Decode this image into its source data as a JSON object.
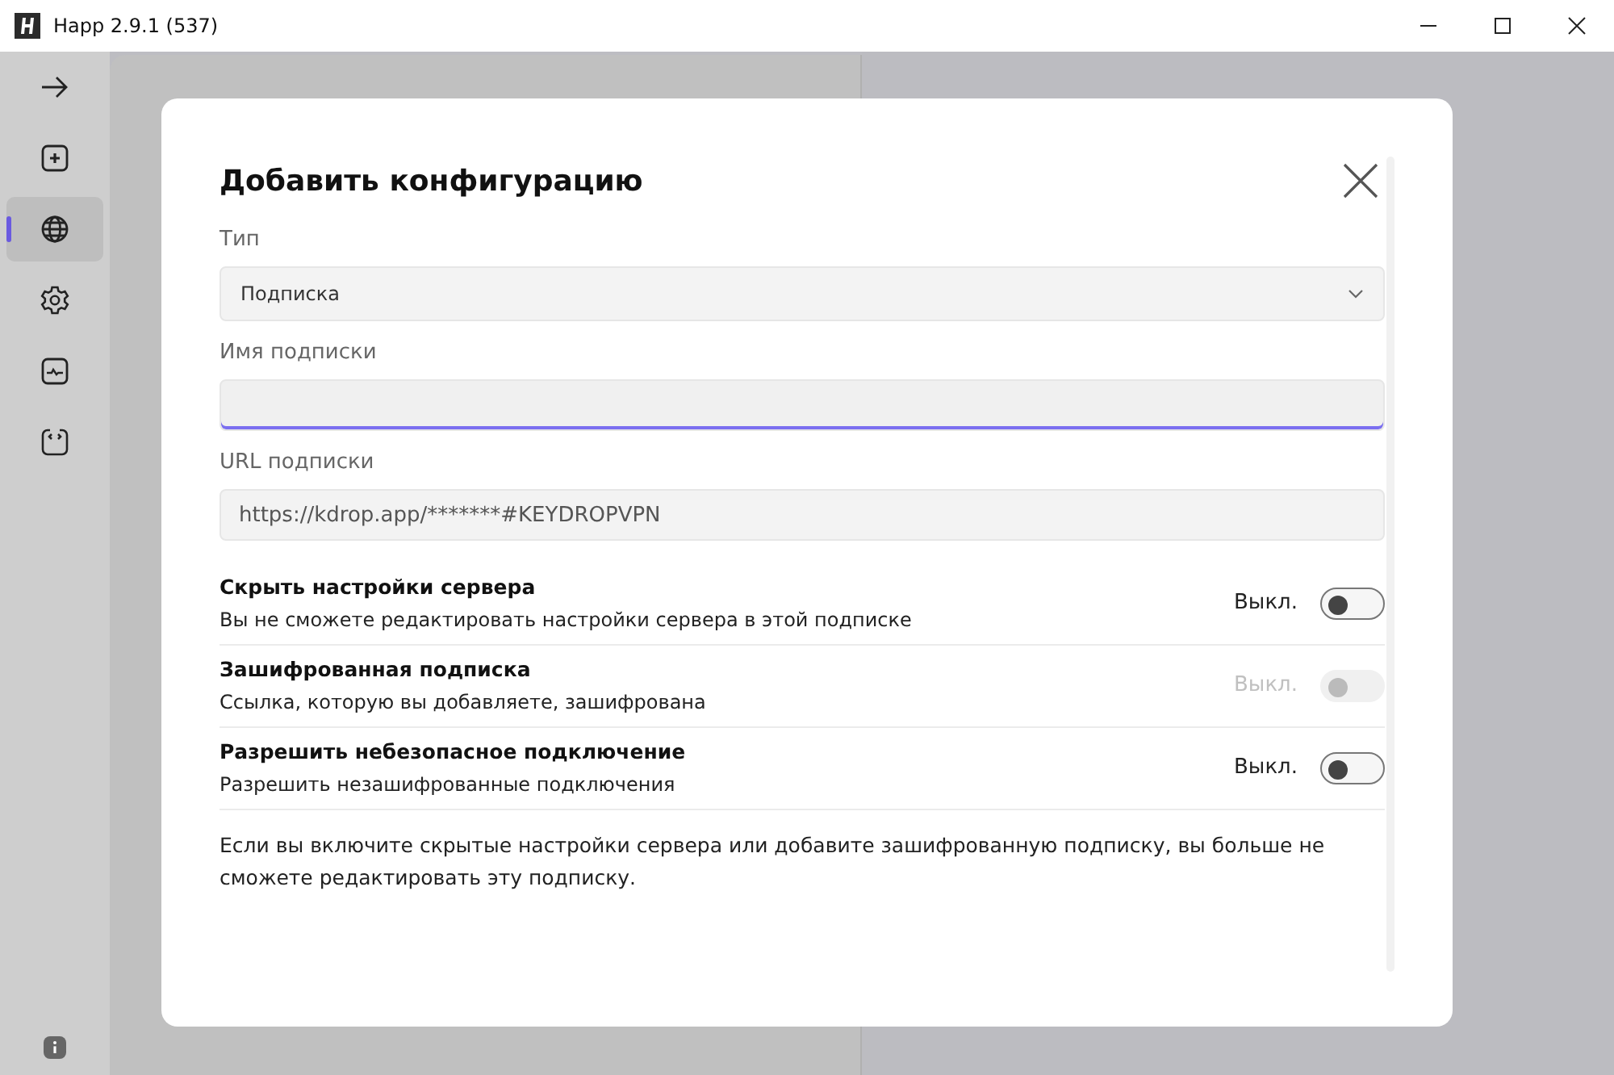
{
  "window": {
    "title": "Happ 2.9.1 (537)"
  },
  "sidebar": {
    "items": [
      {
        "kind": "arrow",
        "selected": false
      },
      {
        "kind": "add",
        "selected": false
      },
      {
        "kind": "globe",
        "selected": true
      },
      {
        "kind": "gear",
        "selected": false
      },
      {
        "kind": "monitor",
        "selected": false
      },
      {
        "kind": "code",
        "selected": false
      }
    ]
  },
  "dialog": {
    "title": "Добавить конфигурацию",
    "fields": [
      {
        "kind": "select",
        "label": "Тип",
        "value": "Подписка"
      },
      {
        "kind": "input",
        "label": "Имя подписки",
        "focused": true
      },
      {
        "kind": "input",
        "label": "URL подписки",
        "value": "https://kdrop.app/*******#KEYDROPVPN",
        "focused": false
      }
    ],
    "settings": [
      {
        "title": "Скрыть настройки сервера",
        "description": "Вы не сможете редактировать настройки сервера в этой подписке",
        "state": "Выкл.",
        "on": false,
        "disabled": false
      },
      {
        "title": "Зашифрованная подписка",
        "description": "Ссылка, которую вы добавляете, зашифрована",
        "state": "Выкл.",
        "on": false,
        "disabled": true
      },
      {
        "title": "Разрешить небезопасное подключение",
        "description": "Разрешить незашифрованные подключения",
        "state": "Выкл.",
        "on": false,
        "disabled": false
      }
    ],
    "note": "Если вы включите скрытые настройки сервера или добавите зашифрованную подписку, вы больше не сможете редактировать эту подписку."
  }
}
